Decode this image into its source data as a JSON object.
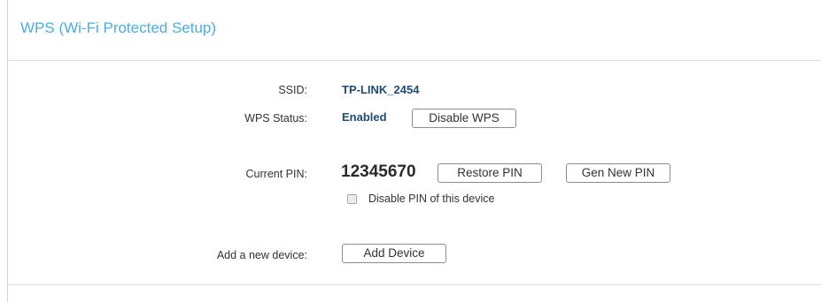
{
  "header": {
    "title": "WPS (Wi-Fi Protected Setup)"
  },
  "ssid": {
    "label": "SSID:",
    "value": "TP-LINK_2454"
  },
  "wps_status": {
    "label": "WPS Status:",
    "value": "Enabled",
    "button_label": "Disable WPS"
  },
  "pin": {
    "label": "Current PIN:",
    "value": "12345670",
    "restore_label": "Restore PIN",
    "gen_label": "Gen New PIN",
    "disable_checkbox_label": "Disable PIN of this device",
    "disable_checked": false
  },
  "add_device": {
    "label": "Add a new device:",
    "button_label": "Add Device"
  },
  "colors": {
    "title": "#4aaee0",
    "value": "#1f4c73"
  }
}
